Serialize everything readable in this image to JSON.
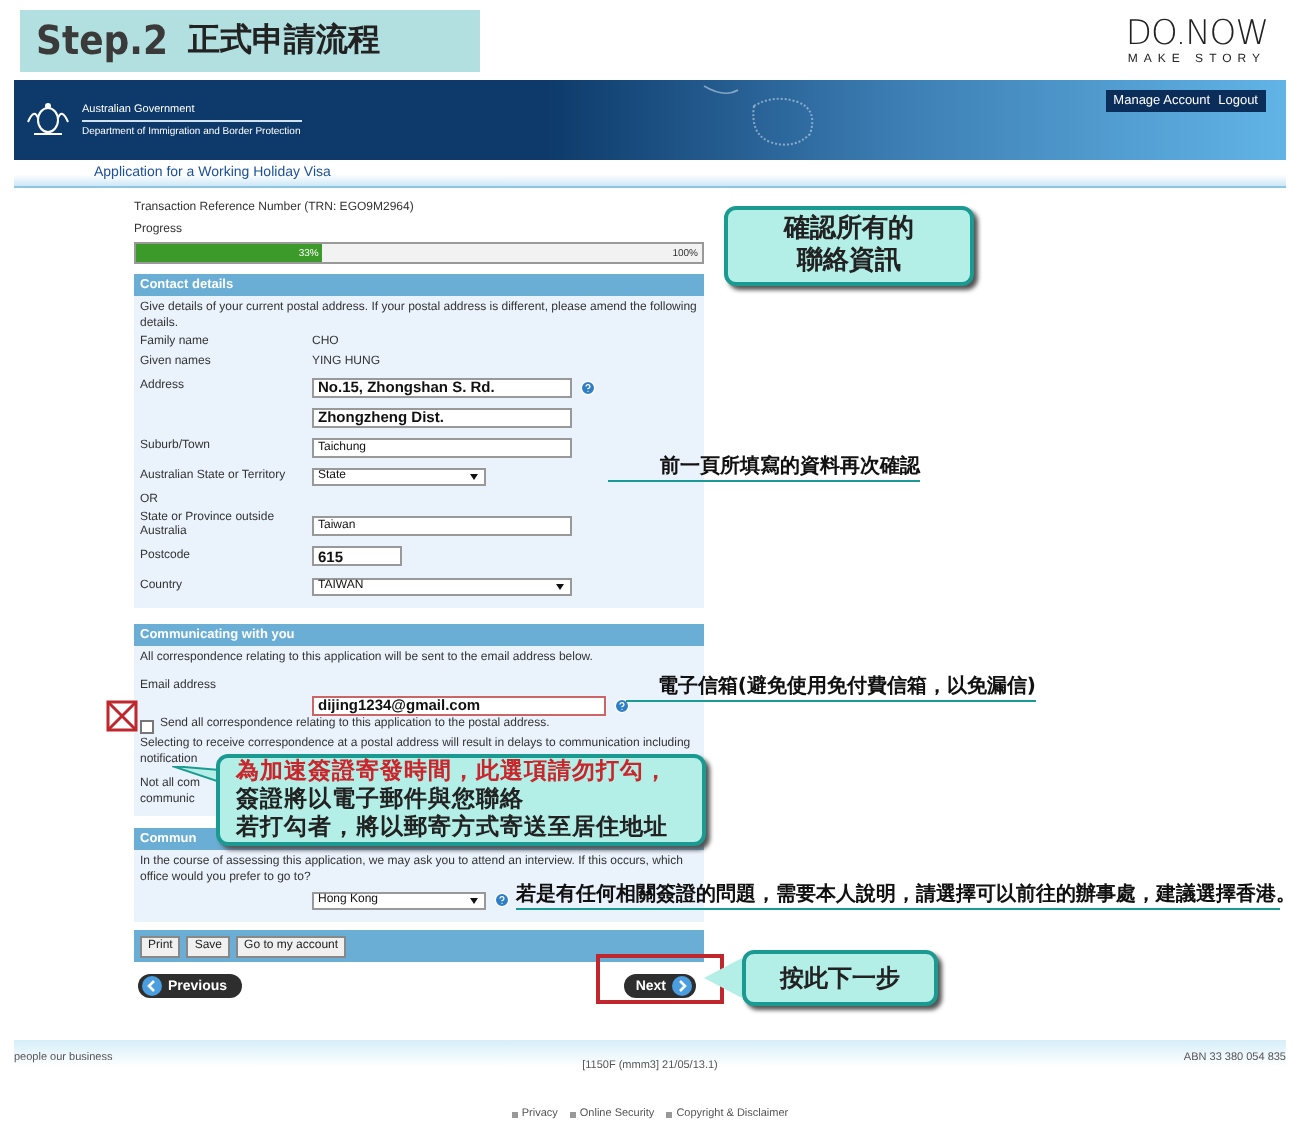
{
  "banner": {
    "step": "Step.2",
    "title": "正式申請流程"
  },
  "logo": {
    "name": "DO.NOW",
    "tagline": "MAKE STORY"
  },
  "gov_header": {
    "line_1": "Australian Government",
    "line_2": "Department of Immigration and Border Protection",
    "links": [
      "Manage Account",
      "Logout"
    ]
  },
  "app_title": "Application for a Working Holiday Visa",
  "trn": "Transaction Reference Number (TRN: EGO9M2964)",
  "progress": {
    "label": "Progress",
    "level": 0.33,
    "reading": "33%",
    "end": "100%"
  },
  "contact": {
    "heading": "Contact details",
    "intro": "Give details of your current postal address. If your postal address is different, please amend the following details.",
    "fields": [
      {
        "kind": "static",
        "label": "Family name",
        "value": "CHO"
      },
      {
        "kind": "static",
        "label": "Given names",
        "value": "YING HUNG"
      },
      {
        "kind": "input",
        "label": "Address",
        "value": "No.15, Zhongshan S. Rd.",
        "bold": true,
        "help": true
      },
      {
        "kind": "input",
        "value": "Zhongzheng Dist.",
        "bold": true,
        "help": false
      },
      {
        "kind": "input",
        "label": "Suburb/Town",
        "value": "Taichung",
        "bold": false,
        "help": false
      },
      {
        "kind": "select",
        "label": "Australian State or Territory",
        "value": "State",
        "help": false
      },
      {
        "kind": "note",
        "label": "OR"
      },
      {
        "kind": "input",
        "label": "State or Province outside Australia",
        "value": "Taiwan",
        "bold": false,
        "help": false
      },
      {
        "kind": "short_input",
        "label": "Postcode",
        "value": "615",
        "bold": true,
        "help": false
      },
      {
        "kind": "wide_select",
        "label": "Country",
        "value": "TAIWAN",
        "help": false
      }
    ]
  },
  "communicating": {
    "heading": "Communicating with you",
    "intro": "All correspondence relating to this application will be sent to the email address below.",
    "email_label": "Email address",
    "email": "dijing1234@gmail.com",
    "checkbox": {
      "label": "Send all correspondence relating to this application to the postal address.",
      "checked": false
    },
    "note": [
      "Selecting to receive correspondence at a postal address will result in delays to communication including",
      "notification"
    ],
    "fragments": [
      "Not all com",
      "communic"
    ]
  },
  "office": {
    "heading": "Commun",
    "question": "In the course of assessing this application, we may ask you to attend an interview. If this occurs, which office would you prefer to go to?",
    "value": "Hong Kong"
  },
  "actions": [
    "Print",
    "Save",
    "Go to my account"
  ],
  "nav": {
    "previous": "Previous",
    "next": "Next"
  },
  "footer": {
    "left": "people our business",
    "center": "[1150F (mmm3] 21/05/13.1)",
    "right": "ABN 33 380 054 835",
    "links": [
      "Privacy",
      "Online Security",
      "Copyright & Disclaimer"
    ]
  },
  "annotations": {
    "confirm_callout": [
      "確認所有的",
      "聯絡資訊"
    ],
    "recheck": "前一頁所填寫的資料再次確認",
    "email_tip": "電子信箱(避免使用免付費信箱，以免漏信)",
    "checkbox_callout": [
      "為加速簽證寄發時間，此選項請勿打勾，",
      "簽證將以電子郵件與您聯絡",
      "若打勾者，將以郵寄方式寄送至居住地址"
    ],
    "office_tip": "若是有任何相關簽證的問題，需要本人說明，請選擇可以前往的辦事處，建議選擇香港。",
    "next_callout": "按此下一步"
  }
}
